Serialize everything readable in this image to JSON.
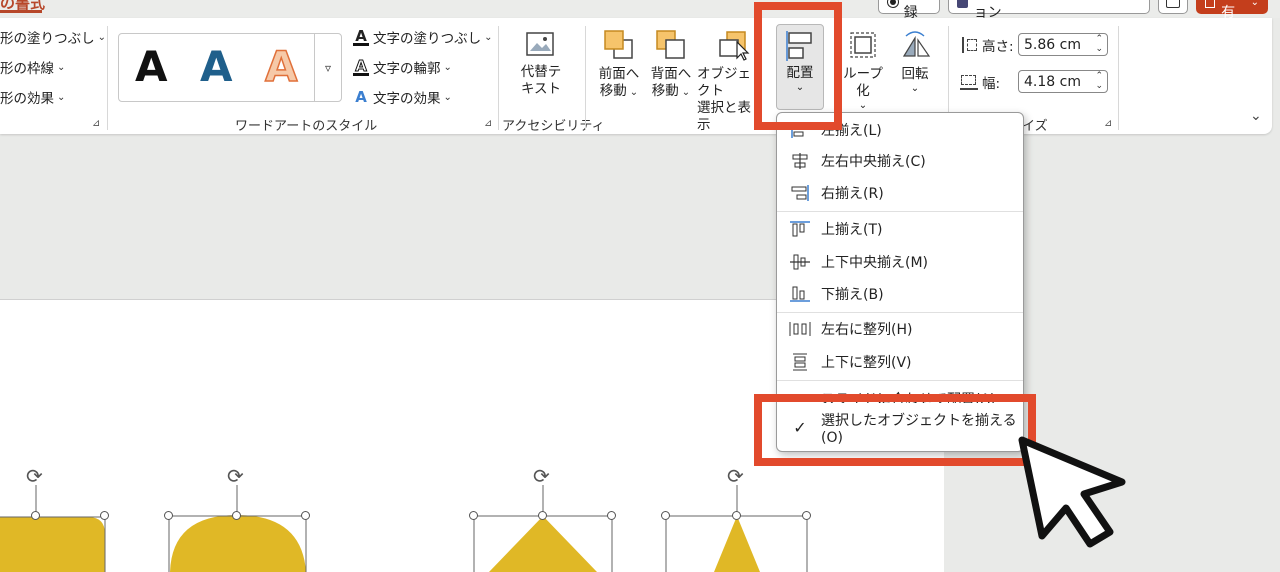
{
  "tabs": {
    "active_tab": "の書式"
  },
  "titlebar": {
    "record_label": "記録",
    "teams_label": "Teams でプレゼンテーション",
    "share_label": "共有"
  },
  "ribbon": {
    "shape_styles": {
      "fill_label": "形の塗りつぶし",
      "outline_label": "形の枠線",
      "effects_label": "形の効果"
    },
    "wordart": {
      "group_label": "ワードアートのスタイル",
      "gallery_letter": "A",
      "text_fill_label": "文字の塗りつぶし",
      "text_outline_label": "文字の輪郭",
      "text_effects_label": "文字の効果"
    },
    "accessibility": {
      "group_label": "アクセシビリティ",
      "alt_text_line1": "代替テ",
      "alt_text_line2": "キスト"
    },
    "arrange": {
      "bring_forward_line1": "前面へ",
      "bring_forward_line2": "移動",
      "send_backward_line1": "背面へ",
      "send_backward_line2": "移動",
      "selection_pane_line1": "オブジェクト",
      "selection_pane_line2": "選択と表示",
      "align_label": "配置",
      "group_label_partial": "ループ化",
      "rotate_label": "回転"
    },
    "size": {
      "group_label_partial": "イズ",
      "height_label": "高さ:",
      "height_value": "5.86 cm",
      "width_label": "幅:",
      "width_value": "4.18 cm"
    }
  },
  "align_menu": {
    "items": [
      {
        "label": "左揃え(L)"
      },
      {
        "label": "左右中央揃え(C)"
      },
      {
        "label": "右揃え(R)"
      },
      {
        "label": "上揃え(T)"
      },
      {
        "label": "上下中央揃え(M)"
      },
      {
        "label": "下揃え(B)"
      },
      {
        "label": "左右に整列(H)"
      },
      {
        "label": "上下に整列(V)"
      },
      {
        "label": "スライドに合わせて配置(A)"
      },
      {
        "label": "選択したオブジェクトを揃える(O)"
      }
    ]
  },
  "colors": {
    "accent_red": "#e24a2c",
    "shape_yellow": "#e0b826",
    "ribbon_bg": "#ffffff",
    "app_bg": "#e9eae8"
  }
}
